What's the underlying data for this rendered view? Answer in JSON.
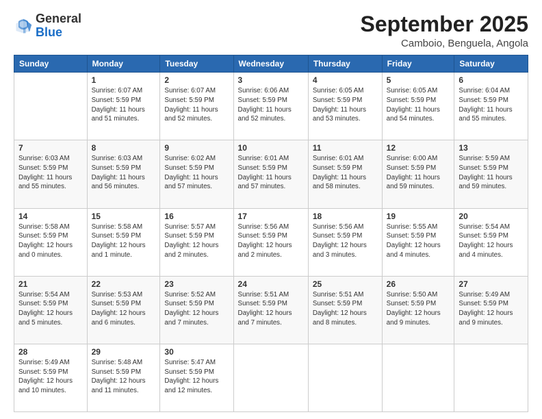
{
  "header": {
    "logo_general": "General",
    "logo_blue": "Blue",
    "title": "September 2025",
    "subtitle": "Camboio, Benguela, Angola"
  },
  "days_of_week": [
    "Sunday",
    "Monday",
    "Tuesday",
    "Wednesday",
    "Thursday",
    "Friday",
    "Saturday"
  ],
  "weeks": [
    [
      {
        "day": "",
        "info": ""
      },
      {
        "day": "1",
        "info": "Sunrise: 6:07 AM\nSunset: 5:59 PM\nDaylight: 11 hours\nand 51 minutes."
      },
      {
        "day": "2",
        "info": "Sunrise: 6:07 AM\nSunset: 5:59 PM\nDaylight: 11 hours\nand 52 minutes."
      },
      {
        "day": "3",
        "info": "Sunrise: 6:06 AM\nSunset: 5:59 PM\nDaylight: 11 hours\nand 52 minutes."
      },
      {
        "day": "4",
        "info": "Sunrise: 6:05 AM\nSunset: 5:59 PM\nDaylight: 11 hours\nand 53 minutes."
      },
      {
        "day": "5",
        "info": "Sunrise: 6:05 AM\nSunset: 5:59 PM\nDaylight: 11 hours\nand 54 minutes."
      },
      {
        "day": "6",
        "info": "Sunrise: 6:04 AM\nSunset: 5:59 PM\nDaylight: 11 hours\nand 55 minutes."
      }
    ],
    [
      {
        "day": "7",
        "info": "Sunrise: 6:03 AM\nSunset: 5:59 PM\nDaylight: 11 hours\nand 55 minutes."
      },
      {
        "day": "8",
        "info": "Sunrise: 6:03 AM\nSunset: 5:59 PM\nDaylight: 11 hours\nand 56 minutes."
      },
      {
        "day": "9",
        "info": "Sunrise: 6:02 AM\nSunset: 5:59 PM\nDaylight: 11 hours\nand 57 minutes."
      },
      {
        "day": "10",
        "info": "Sunrise: 6:01 AM\nSunset: 5:59 PM\nDaylight: 11 hours\nand 57 minutes."
      },
      {
        "day": "11",
        "info": "Sunrise: 6:01 AM\nSunset: 5:59 PM\nDaylight: 11 hours\nand 58 minutes."
      },
      {
        "day": "12",
        "info": "Sunrise: 6:00 AM\nSunset: 5:59 PM\nDaylight: 11 hours\nand 59 minutes."
      },
      {
        "day": "13",
        "info": "Sunrise: 5:59 AM\nSunset: 5:59 PM\nDaylight: 11 hours\nand 59 minutes."
      }
    ],
    [
      {
        "day": "14",
        "info": "Sunrise: 5:58 AM\nSunset: 5:59 PM\nDaylight: 12 hours\nand 0 minutes."
      },
      {
        "day": "15",
        "info": "Sunrise: 5:58 AM\nSunset: 5:59 PM\nDaylight: 12 hours\nand 1 minute."
      },
      {
        "day": "16",
        "info": "Sunrise: 5:57 AM\nSunset: 5:59 PM\nDaylight: 12 hours\nand 2 minutes."
      },
      {
        "day": "17",
        "info": "Sunrise: 5:56 AM\nSunset: 5:59 PM\nDaylight: 12 hours\nand 2 minutes."
      },
      {
        "day": "18",
        "info": "Sunrise: 5:56 AM\nSunset: 5:59 PM\nDaylight: 12 hours\nand 3 minutes."
      },
      {
        "day": "19",
        "info": "Sunrise: 5:55 AM\nSunset: 5:59 PM\nDaylight: 12 hours\nand 4 minutes."
      },
      {
        "day": "20",
        "info": "Sunrise: 5:54 AM\nSunset: 5:59 PM\nDaylight: 12 hours\nand 4 minutes."
      }
    ],
    [
      {
        "day": "21",
        "info": "Sunrise: 5:54 AM\nSunset: 5:59 PM\nDaylight: 12 hours\nand 5 minutes."
      },
      {
        "day": "22",
        "info": "Sunrise: 5:53 AM\nSunset: 5:59 PM\nDaylight: 12 hours\nand 6 minutes."
      },
      {
        "day": "23",
        "info": "Sunrise: 5:52 AM\nSunset: 5:59 PM\nDaylight: 12 hours\nand 7 minutes."
      },
      {
        "day": "24",
        "info": "Sunrise: 5:51 AM\nSunset: 5:59 PM\nDaylight: 12 hours\nand 7 minutes."
      },
      {
        "day": "25",
        "info": "Sunrise: 5:51 AM\nSunset: 5:59 PM\nDaylight: 12 hours\nand 8 minutes."
      },
      {
        "day": "26",
        "info": "Sunrise: 5:50 AM\nSunset: 5:59 PM\nDaylight: 12 hours\nand 9 minutes."
      },
      {
        "day": "27",
        "info": "Sunrise: 5:49 AM\nSunset: 5:59 PM\nDaylight: 12 hours\nand 9 minutes."
      }
    ],
    [
      {
        "day": "28",
        "info": "Sunrise: 5:49 AM\nSunset: 5:59 PM\nDaylight: 12 hours\nand 10 minutes."
      },
      {
        "day": "29",
        "info": "Sunrise: 5:48 AM\nSunset: 5:59 PM\nDaylight: 12 hours\nand 11 minutes."
      },
      {
        "day": "30",
        "info": "Sunrise: 5:47 AM\nSunset: 5:59 PM\nDaylight: 12 hours\nand 12 minutes."
      },
      {
        "day": "",
        "info": ""
      },
      {
        "day": "",
        "info": ""
      },
      {
        "day": "",
        "info": ""
      },
      {
        "day": "",
        "info": ""
      }
    ]
  ]
}
